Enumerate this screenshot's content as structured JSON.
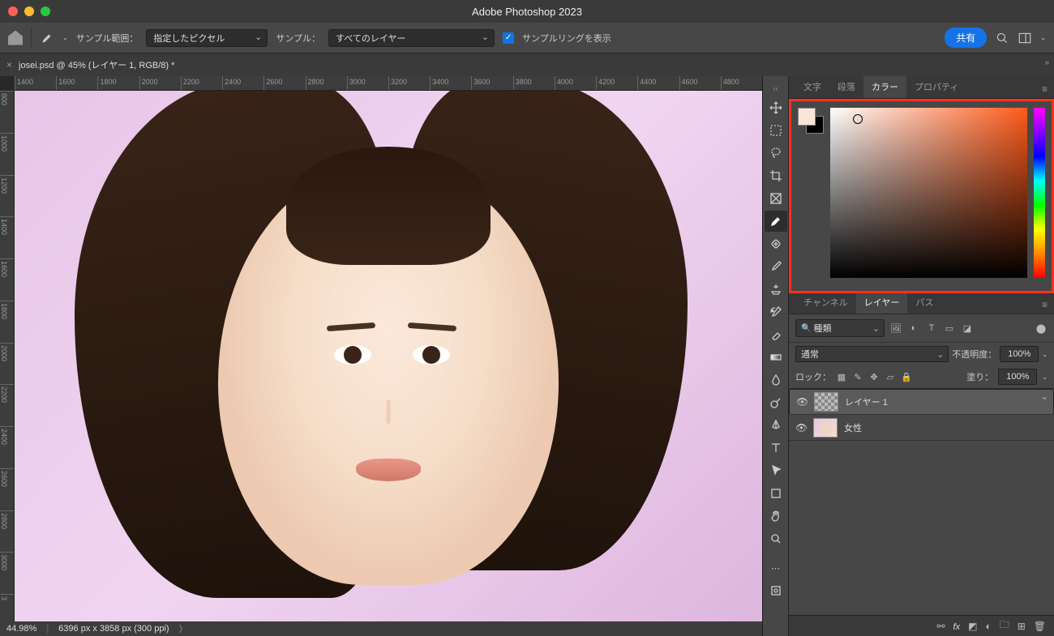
{
  "app": {
    "title": "Adobe Photoshop 2023"
  },
  "optbar": {
    "sample_range_lbl": "サンプル範囲：",
    "sample_range_val": "指定したピクセル",
    "sample_lbl": "サンプル：",
    "sample_val": "すべてのレイヤー",
    "ring_lbl": "サンプルリングを表示",
    "share": "共有"
  },
  "doc": {
    "tab": "josei.psd @ 45% (レイヤー 1, RGB/8) *"
  },
  "ruler_h": [
    "1400",
    "1600",
    "1800",
    "2000",
    "2200",
    "2400",
    "2600",
    "2800",
    "3000",
    "3200",
    "3400",
    "3600",
    "3800",
    "4000",
    "4200",
    "4400",
    "4600",
    "4800"
  ],
  "ruler_v": [
    "800",
    "1000",
    "1200",
    "1400",
    "1600",
    "1800",
    "2000",
    "2200",
    "2400",
    "2600",
    "2800",
    "3000",
    "3"
  ],
  "panel_top": {
    "tabs": [
      "文字",
      "段落",
      "カラー",
      "プロパティ"
    ],
    "active": "カラー"
  },
  "panel_layers": {
    "tabs": [
      "チャンネル",
      "レイヤー",
      "パス"
    ],
    "active": "レイヤー",
    "kind": "種類",
    "blend": "通常",
    "opacity_lbl": "不透明度：",
    "opacity_val": "100%",
    "lock_lbl": "ロック：",
    "fill_lbl": "塗り：",
    "fill_val": "100%",
    "layers": [
      {
        "name": "レイヤー 1",
        "selected": true,
        "thumb": "trans"
      },
      {
        "name": "女性",
        "selected": false,
        "thumb": "img"
      }
    ]
  },
  "status": {
    "zoom": "44.98%",
    "dims": "6396 px x 3858 px (300 ppi)"
  },
  "colors": {
    "fg": "#f8e5d8",
    "bg": "#000000",
    "hue": "#ff5a1a",
    "highlight": "#ff3020"
  }
}
